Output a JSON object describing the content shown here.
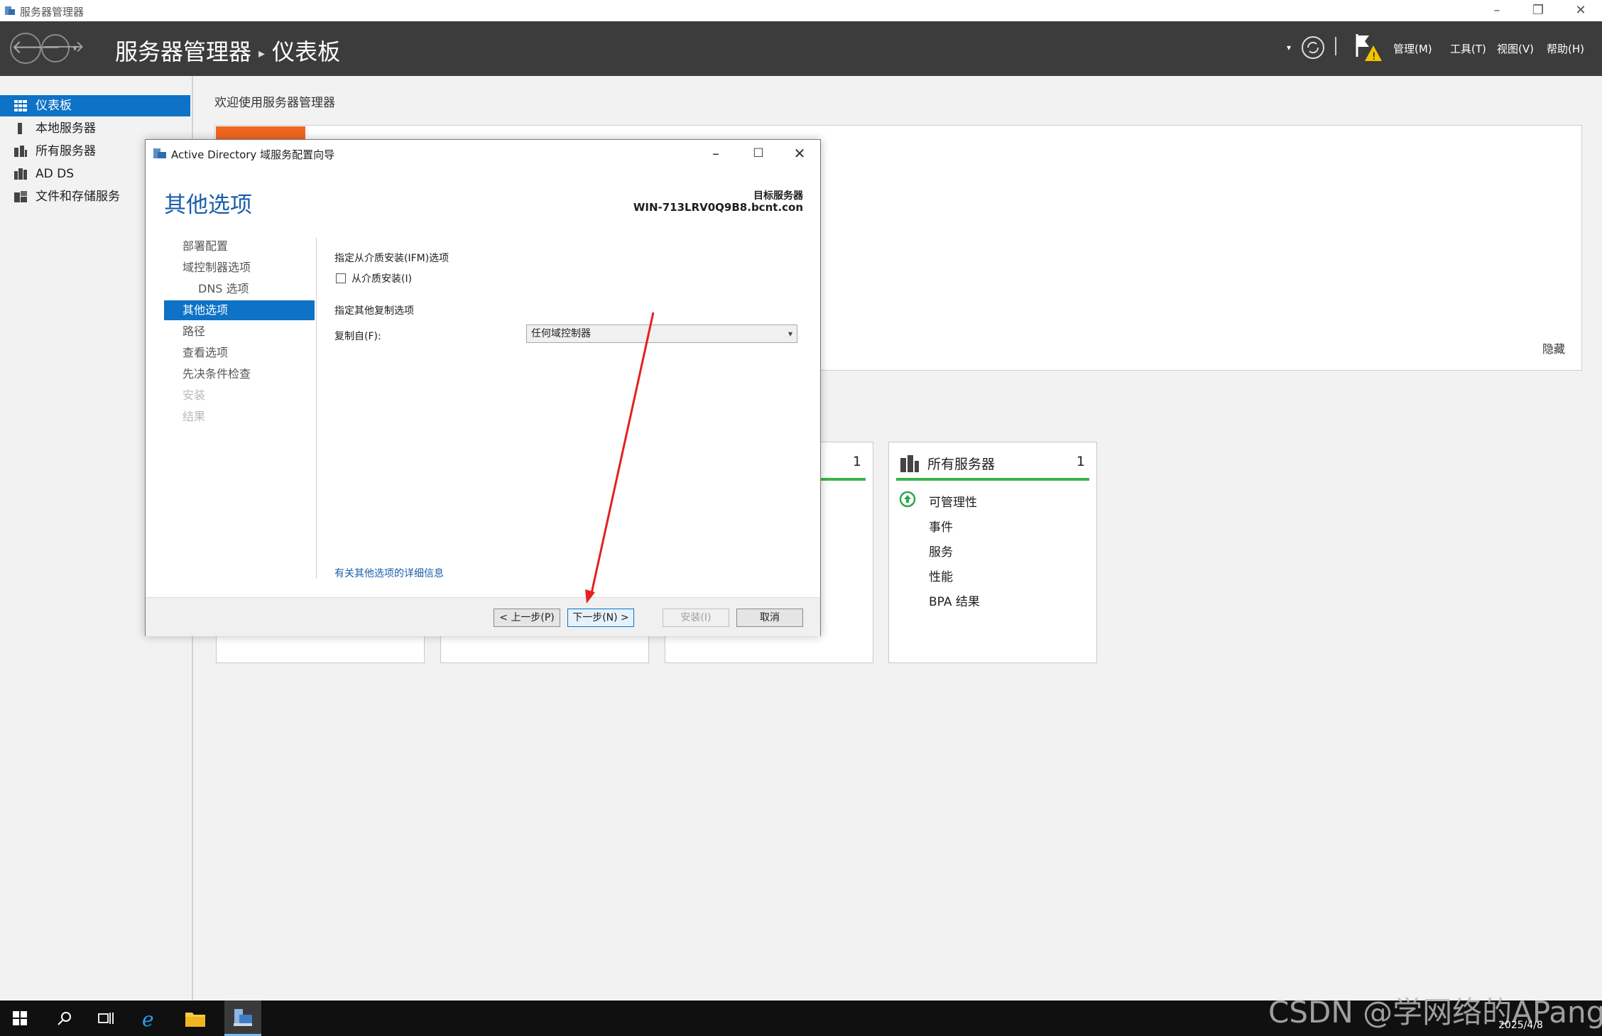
{
  "window": {
    "title": "服务器管理器",
    "controls": {
      "minimize": "–",
      "restore": "❐",
      "close": "✕"
    }
  },
  "header": {
    "app_name": "服务器管理器",
    "page": "仪表板",
    "menus": [
      "管理(M)",
      "工具(T)",
      "视图(V)",
      "帮助(H)"
    ]
  },
  "sidebar": {
    "items": [
      {
        "label": "仪表板",
        "icon": "dashboard-icon",
        "active": true
      },
      {
        "label": "本地服务器",
        "icon": "server-icon"
      },
      {
        "label": "所有服务器",
        "icon": "servers-icon"
      },
      {
        "label": "AD DS",
        "icon": "adds-icon"
      },
      {
        "label": "文件和存储服务",
        "icon": "storage-icon"
      }
    ]
  },
  "main": {
    "welcome_title": "欢迎使用服务器管理器",
    "hide_link": "隐藏",
    "tile_partial": {
      "count": "1"
    },
    "tile_all_servers": {
      "title": "所有服务器",
      "count": "1",
      "rows": [
        "可管理性",
        "事件",
        "服务",
        "性能",
        "BPA 结果"
      ]
    }
  },
  "wizard": {
    "title": "Active Directory 域服务配置向导",
    "heading": "其他选项",
    "target_label": "目标服务器",
    "target_server": "WIN-713LRV0Q9B8.bcnt.con",
    "nav": [
      {
        "label": "部署配置",
        "state": "normal"
      },
      {
        "label": "域控制器选项",
        "state": "normal"
      },
      {
        "label": "DNS 选项",
        "state": "sub"
      },
      {
        "label": "其他选项",
        "state": "active"
      },
      {
        "label": "路径",
        "state": "normal"
      },
      {
        "label": "查看选项",
        "state": "normal"
      },
      {
        "label": "先决条件检查",
        "state": "normal"
      },
      {
        "label": "安装",
        "state": "disabled"
      },
      {
        "label": "结果",
        "state": "disabled"
      }
    ],
    "ifm_section": "指定从介质安装(IFM)选项",
    "ifm_checkbox": "从介质安装(I)",
    "replication_section": "指定其他复制选项",
    "replicate_from_label": "复制自(F):",
    "replicate_from_value": "任何域控制器",
    "more_info_link": "有关其他选项的详细信息",
    "buttons": {
      "back": "< 上一步(P)",
      "next": "下一步(N) >",
      "install": "安装(I)",
      "cancel": "取消"
    }
  },
  "taskbar": {
    "date": "2025/4/8",
    "watermark": "CSDN @学网络的APang"
  },
  "colors": {
    "accent": "#0e72c6",
    "header_bg": "#3c3c3c",
    "status_green": "#3cb44a",
    "welcome_orange": "#f26522",
    "annotation_red": "#e62020"
  }
}
